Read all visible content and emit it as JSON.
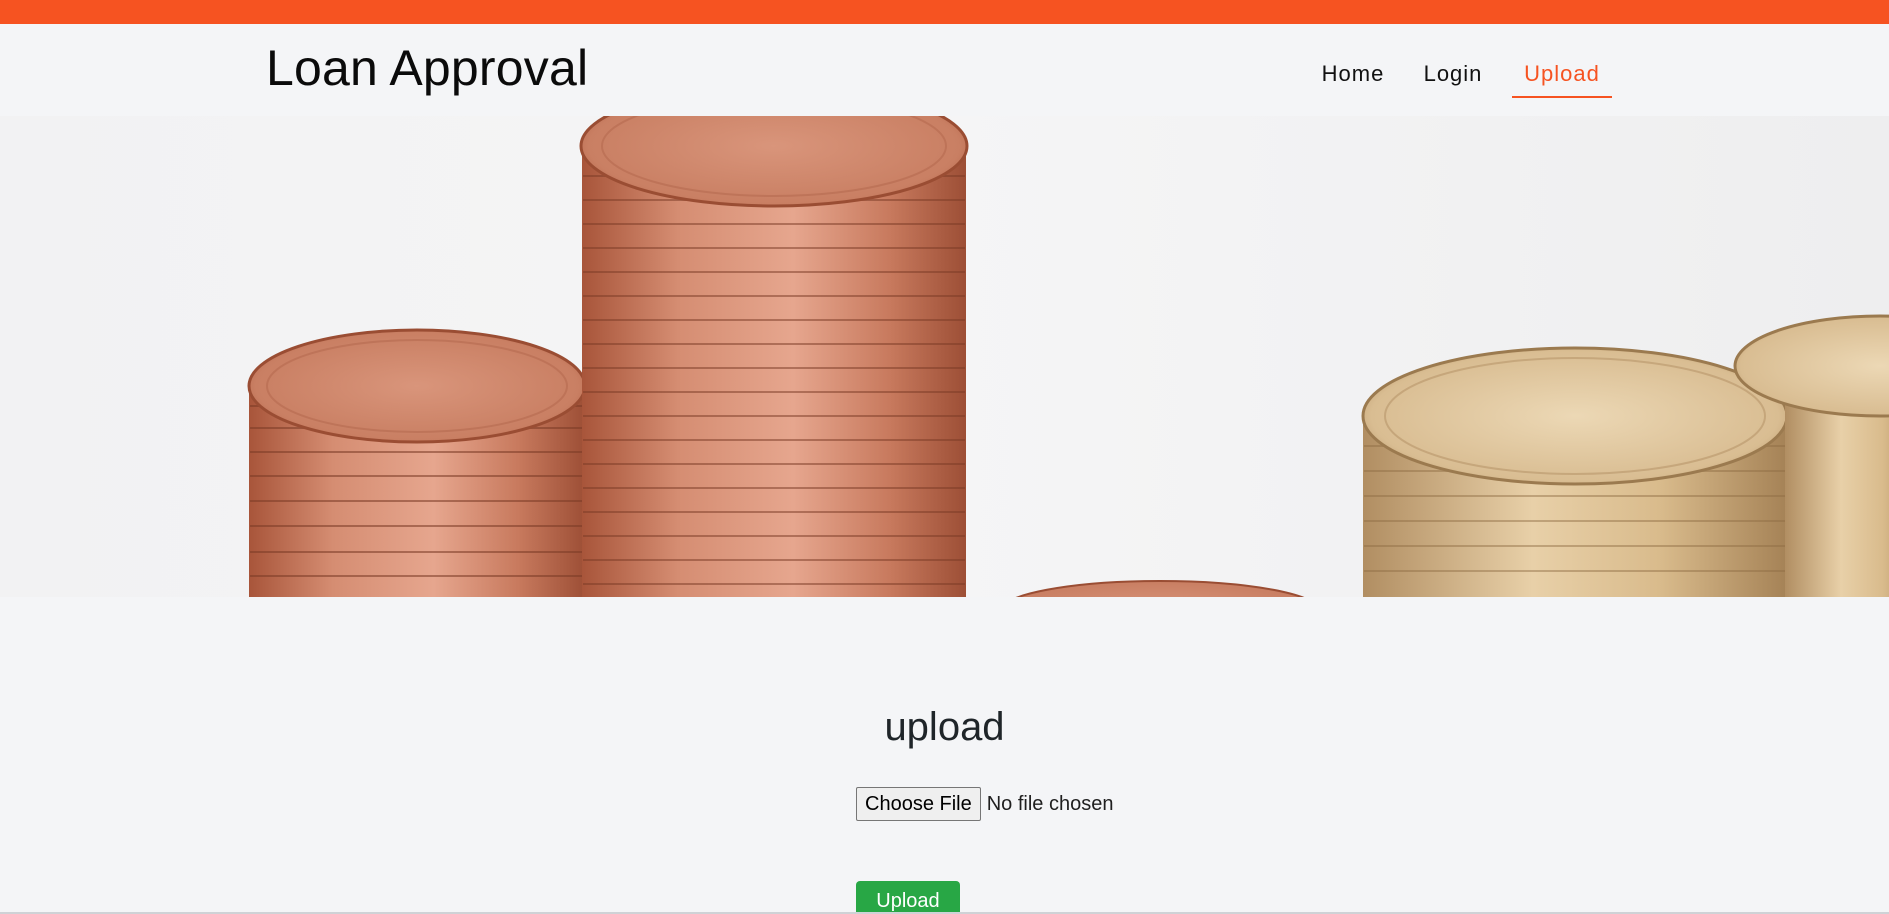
{
  "header": {
    "brand": "Loan Approval",
    "nav": [
      {
        "label": "Home"
      },
      {
        "label": "Login"
      },
      {
        "label": "Upload"
      }
    ],
    "active_nav": "Upload"
  },
  "colors": {
    "accent": "#f65321",
    "success": "#28a745",
    "background": "#f4f5f7"
  },
  "hero": {
    "image_alt": "stacks of copper and gold euro coins"
  },
  "upload": {
    "title": "upload",
    "file_input": {
      "button_label": "Choose File",
      "status": "No file chosen"
    },
    "submit_label": "Upload"
  }
}
